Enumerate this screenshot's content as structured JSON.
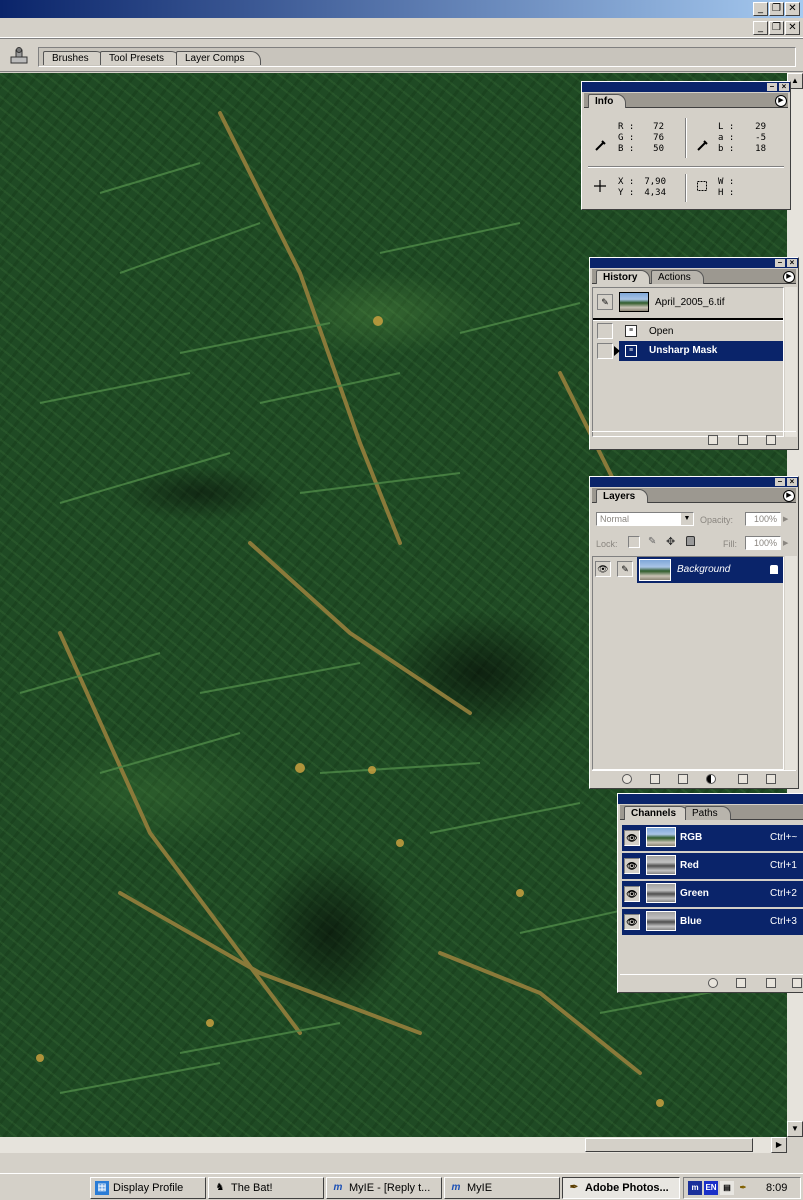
{
  "options_bar": {
    "tabs": [
      "Brushes",
      "Tool Presets",
      "Layer Comps"
    ]
  },
  "info": {
    "tab": "Info",
    "rgb": {
      "r_label": "R :",
      "g_label": "G :",
      "b_label": "B :",
      "r": "72",
      "g": "76",
      "b": "50"
    },
    "lab": {
      "l_label": "L :",
      "a_label": "a :",
      "b_label": "b :",
      "l": "29",
      "a": "-5",
      "b": "18"
    },
    "xy": {
      "x_label": "X :",
      "y_label": "Y :",
      "x": "7,90",
      "y": "4,34"
    },
    "wh": {
      "w_label": "W :",
      "h_label": "H :"
    }
  },
  "history": {
    "tabs": [
      "History",
      "Actions"
    ],
    "snapshot": "April_2005_6.tif",
    "items": [
      "Open",
      "Unsharp Mask"
    ],
    "selected_index": 1
  },
  "layers": {
    "tab": "Layers",
    "blend_mode": "Normal",
    "opacity_label": "Opacity:",
    "opacity": "100%",
    "lock_label": "Lock:",
    "fill_label": "Fill:",
    "fill": "100%",
    "layer_name": "Background"
  },
  "channels": {
    "tabs": [
      "Channels",
      "Paths"
    ],
    "items": [
      {
        "name": "RGB",
        "shortcut": "Ctrl+~"
      },
      {
        "name": "Red",
        "shortcut": "Ctrl+1"
      },
      {
        "name": "Green",
        "shortcut": "Ctrl+2"
      },
      {
        "name": "Blue",
        "shortcut": "Ctrl+3"
      }
    ]
  },
  "taskbar": {
    "tasks": [
      {
        "label": "Display Profile",
        "icon": "display-profile-icon"
      },
      {
        "label": "The Bat!",
        "icon": "bat-icon"
      },
      {
        "label": "MyIE - [Reply t...",
        "icon": "myie-icon"
      },
      {
        "label": "MyIE",
        "icon": "myie-icon"
      },
      {
        "label": "Adobe Photos...",
        "icon": "photoshop-icon"
      }
    ],
    "tray_lang": "EN",
    "clock": "8:09"
  },
  "colors": {
    "selection": "#0a246a",
    "panel": "#d4d0c8",
    "foliage": "#1f4a24"
  }
}
